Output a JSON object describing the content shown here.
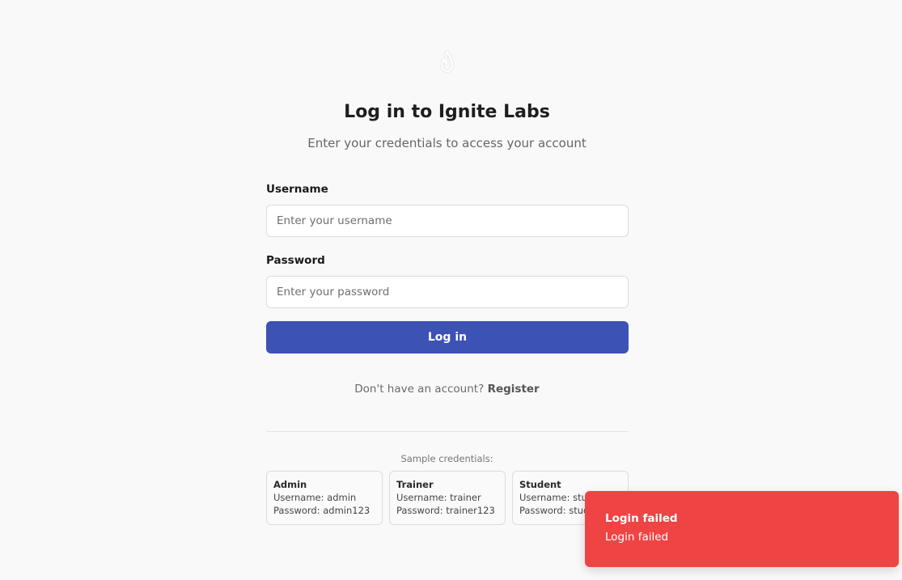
{
  "header": {
    "logo_icon": "flame-icon",
    "title": "Log in to Ignite Labs",
    "subtitle": "Enter your credentials to access your account"
  },
  "form": {
    "username_label": "Username",
    "username_placeholder": "Enter your username",
    "username_value": "",
    "password_label": "Password",
    "password_placeholder": "Enter your password",
    "password_value": "",
    "submit_label": "Log in"
  },
  "register": {
    "prompt": "Don't have an account?",
    "link_label": "Register"
  },
  "samples": {
    "title": "Sample credentials:",
    "cards": [
      {
        "role": "Admin",
        "username": "Username: admin",
        "password": "Password: admin123"
      },
      {
        "role": "Trainer",
        "username": "Username: trainer",
        "password": "Password: trainer123"
      },
      {
        "role": "Student",
        "username": "Username: student",
        "password": "Password: student123"
      }
    ]
  },
  "toast": {
    "title": "Login failed",
    "description": "Login failed"
  },
  "colors": {
    "primary": "#3d52b5",
    "error": "#ef4444",
    "background": "#f9f9f9"
  }
}
